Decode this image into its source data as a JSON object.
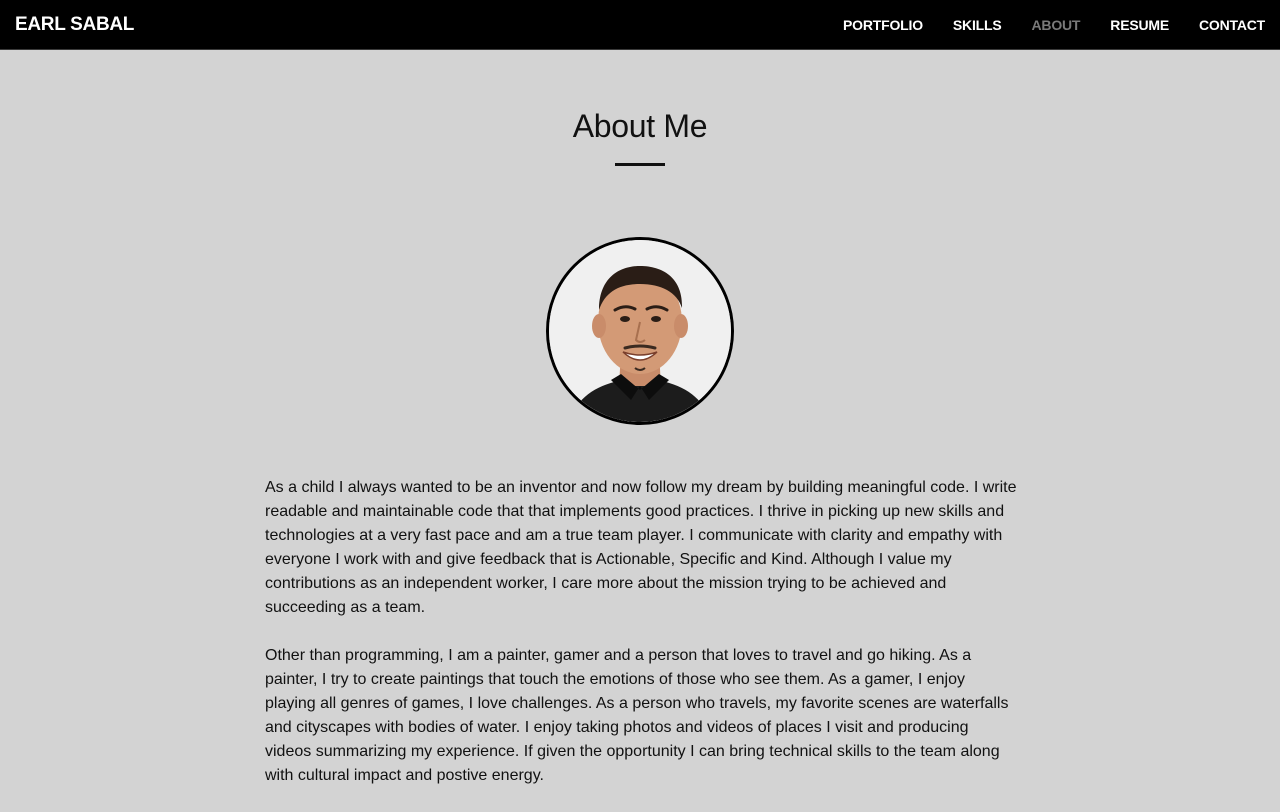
{
  "header": {
    "brand": "EARL SABAL",
    "nav": [
      {
        "label": "PORTFOLIO",
        "active": false
      },
      {
        "label": "SKILLS",
        "active": false
      },
      {
        "label": "ABOUT",
        "active": true
      },
      {
        "label": "RESUME",
        "active": false
      },
      {
        "label": "CONTACT",
        "active": false
      }
    ],
    "active_color": "#7a7a7a"
  },
  "main": {
    "title": "About Me",
    "avatar_icon": "profile-photo",
    "paragraphs": [
      "As a child I always wanted to be an inventor and now follow my dream by building meaningful code. I write readable and maintainable code that that implements good practices. I thrive in picking up new skills and technologies at a very fast pace and am a true team player. I communicate with clarity and empathy with everyone I work with and give feedback that is Actionable, Specific and Kind. Although I value my contributions as an independent worker, I care more about the mission trying to be achieved and succeeding as a team.",
      "Other than programming, I am a painter, gamer and a person that loves to travel and go hiking. As a painter, I try to create paintings that touch the emotions of those who see them. As a gamer, I enjoy playing all genres of games, I love challenges. As a person who travels, my favorite scenes are waterfalls and cityscapes with bodies of water. I enjoy taking photos and videos of places I visit and producing videos summarizing my experience. If given the opportunity I can bring technical skills to the team along with cultural impact and postive energy."
    ]
  },
  "colors": {
    "page_background": "#d3d3d3",
    "header_background": "#000000",
    "text": "#111111"
  }
}
